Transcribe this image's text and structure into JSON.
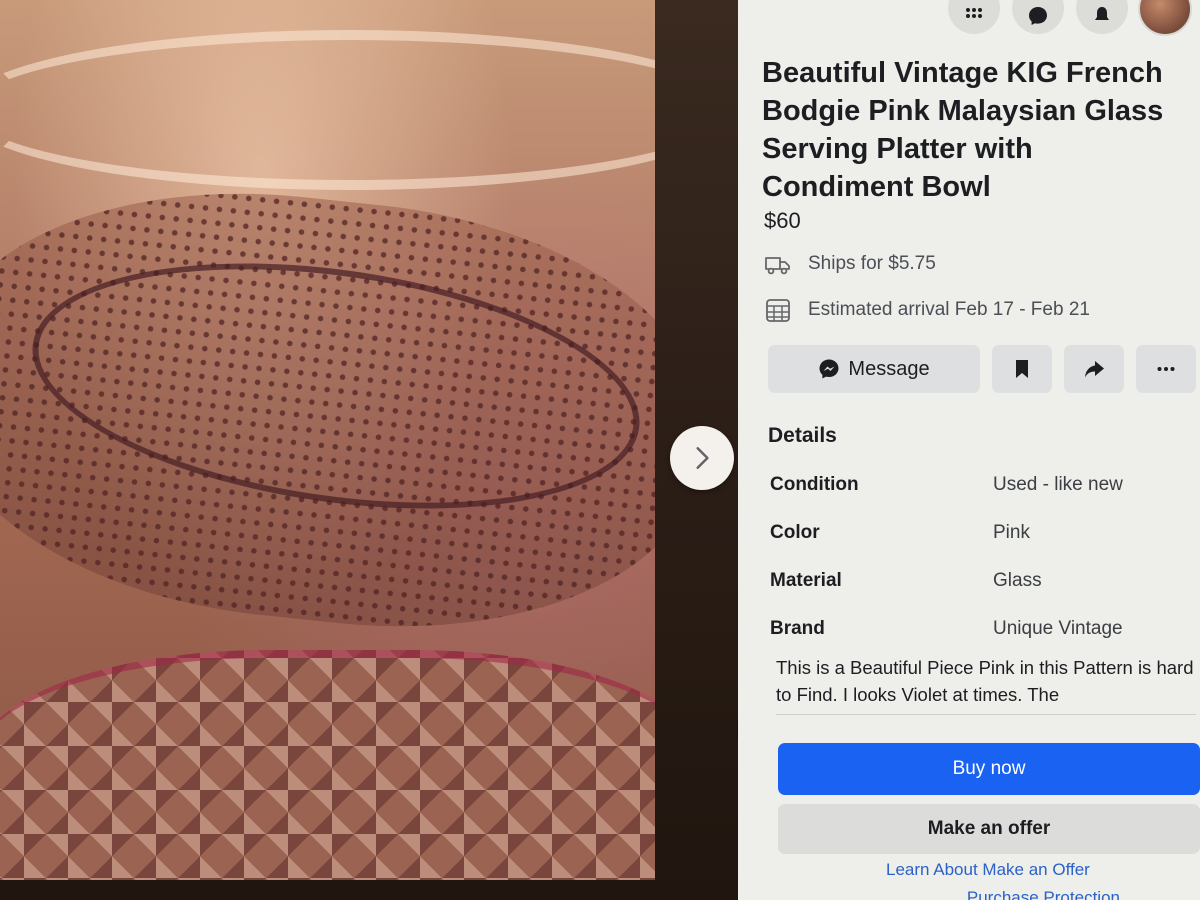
{
  "photo": {
    "alt": "",
    "next_icon": "chevron-right-icon"
  },
  "topbar": {
    "icons": [
      "apps-grid-icon",
      "messenger-icon",
      "notifications-bell-icon"
    ],
    "avatar": "profile-avatar"
  },
  "listing": {
    "title": "Beautiful Vintage KIG French Bodgie Pink Malaysian Glass Serving Platter with Condiment Bowl",
    "price": "$60",
    "shipping": {
      "icon": "truck-icon",
      "text": "Ships for $5.75"
    },
    "arrival": {
      "icon": "calendar-icon",
      "text": "Estimated arrival Feb 17 - Feb 21"
    }
  },
  "actions": {
    "message_label": "Message",
    "message_icon": "messenger-icon",
    "save_icon": "bookmark-icon",
    "share_icon": "share-icon",
    "more_icon": "more-options-icon"
  },
  "details": {
    "heading": "Details",
    "rows": [
      {
        "label": "Condition",
        "value": "Used - like new"
      },
      {
        "label": "Color",
        "value": "Pink"
      },
      {
        "label": "Material",
        "value": "Glass"
      },
      {
        "label": "Brand",
        "value": "Unique Vintage"
      }
    ],
    "description": "This is a Beautiful Piece Pink in this Pattern is hard to Find. I looks Violet at times. The"
  },
  "purchase": {
    "buy_now": "Buy now",
    "make_offer": "Make an offer",
    "learn_link": "Learn About Make an Offer",
    "protection_link": "... Purchase Protection"
  },
  "colors": {
    "buy_blue": "#1a63f2",
    "panel_bg": "#eeeeea",
    "link_blue": "#2a62c9"
  }
}
